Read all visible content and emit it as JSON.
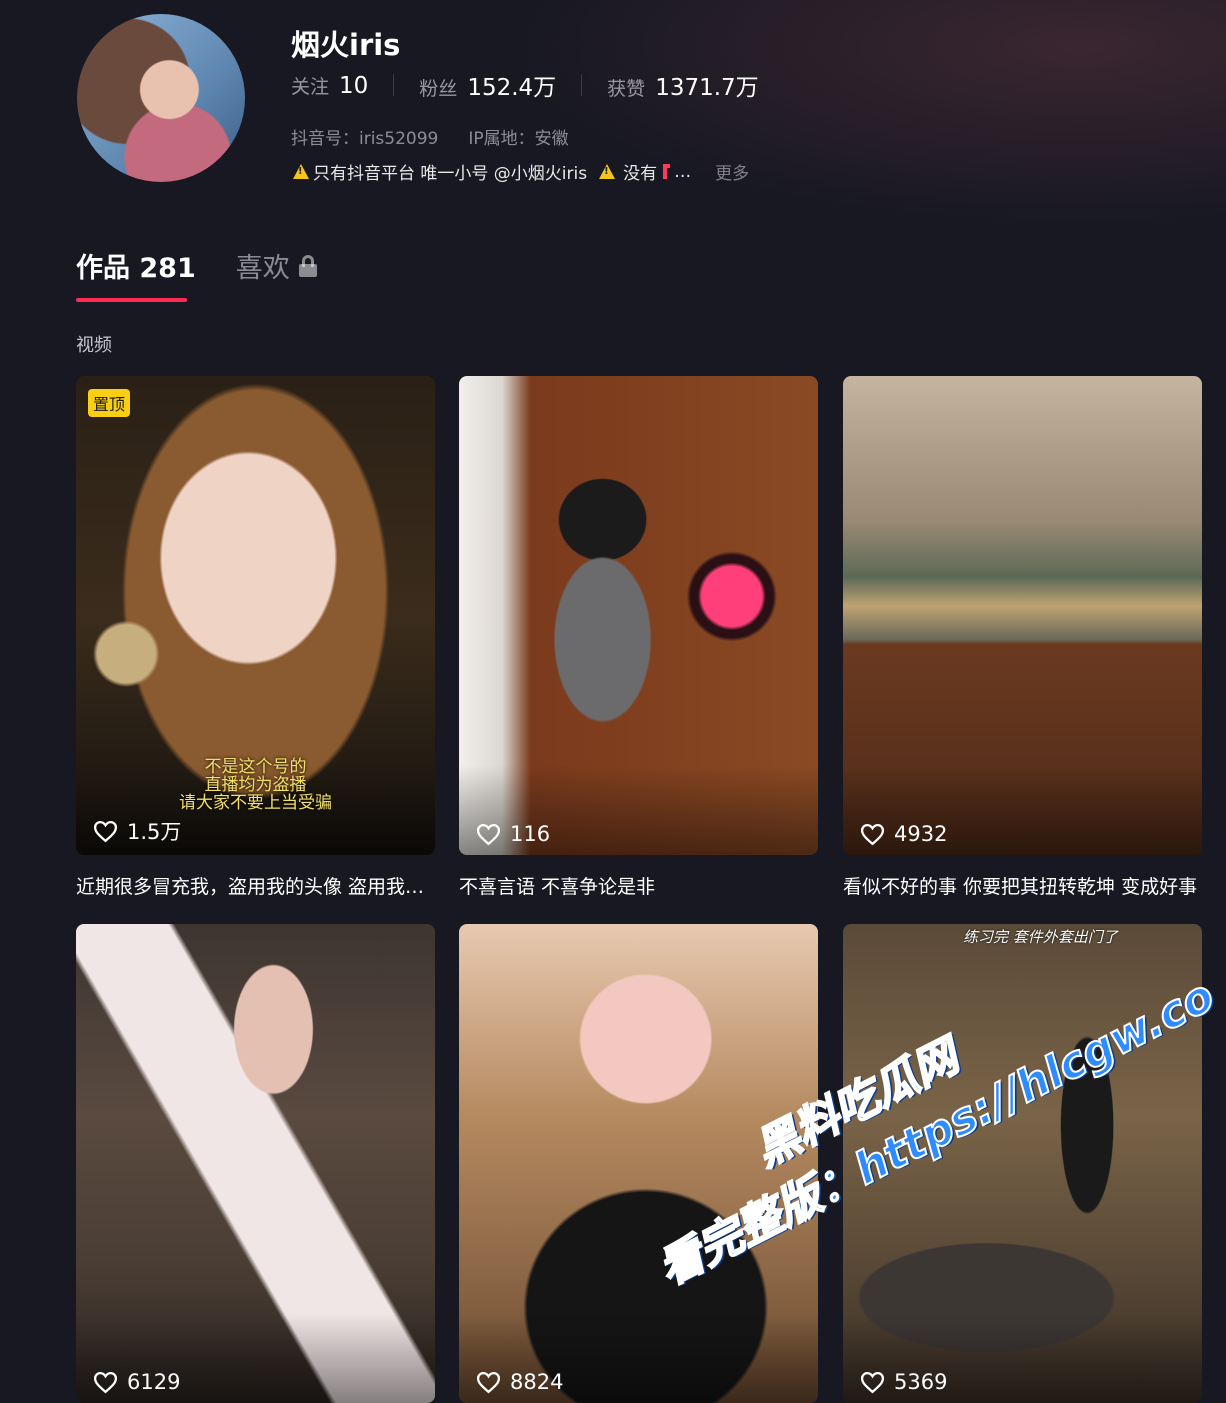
{
  "profile": {
    "nickname": "烟火iris",
    "following_label": "关注",
    "following_count": "10",
    "followers_label": "粉丝",
    "followers_count": "152.4万",
    "likes_label": "获赞",
    "likes_count": "1371.7万",
    "douyin_id": "抖音号：iris52099",
    "ip_location": "IP属地：安徽",
    "bio_part1": "只有抖音平台 唯一小号 @小烟火iris",
    "bio_part2": "没有",
    "bio_ellipsis": "…",
    "more_label": "更多"
  },
  "tabs": {
    "works": "作品 281",
    "likes": "喜欢"
  },
  "section_label": "视频",
  "colors": {
    "accent": "#fe2c55",
    "pin_badge": "#face15",
    "background": "#171822"
  },
  "videos": [
    {
      "pin_label": "置顶",
      "overlay": [
        "不是这个号的",
        "直播均为盗播",
        "请大家不要上当受骗"
      ],
      "likes": "1.5万",
      "caption": "近期很多冒充我，盗用我的头像 盗用我的视频"
    },
    {
      "likes": "116",
      "caption": "不喜言语 不喜争论是非"
    },
    {
      "likes": "4932",
      "caption": "看似不好的事 你要把其扭转乾坤 变成好事"
    },
    {
      "likes": "6129",
      "caption": ""
    },
    {
      "likes": "8824",
      "caption": ""
    },
    {
      "top_text": "练习完 套件外套出门了",
      "likes": "5369",
      "caption": ""
    }
  ],
  "watermark": {
    "line1": "黑料吃瓜网",
    "line2": "看完整版：https://hlcgw.co"
  },
  "icons": [
    "warning-icon",
    "lock-icon",
    "heart-icon"
  ]
}
